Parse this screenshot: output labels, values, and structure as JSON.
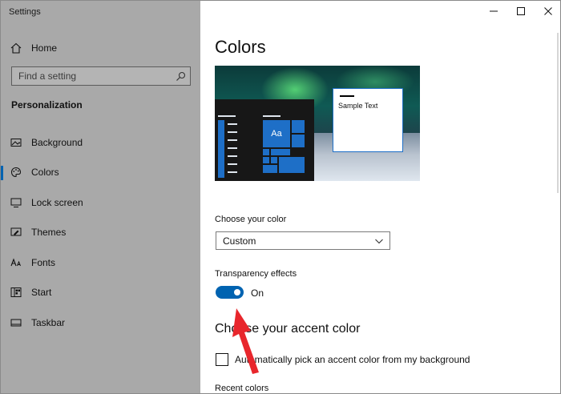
{
  "window": {
    "title": "Settings"
  },
  "sidebar": {
    "home_label": "Home",
    "search_placeholder": "Find a setting",
    "section": "Personalization",
    "items": [
      {
        "label": "Background",
        "icon": "picture-icon"
      },
      {
        "label": "Colors",
        "icon": "palette-icon",
        "active": true
      },
      {
        "label": "Lock screen",
        "icon": "lock-screen-icon"
      },
      {
        "label": "Themes",
        "icon": "brush-icon"
      },
      {
        "label": "Fonts",
        "icon": "font-icon"
      },
      {
        "label": "Start",
        "icon": "start-grid-icon"
      },
      {
        "label": "Taskbar",
        "icon": "taskbar-icon"
      }
    ]
  },
  "main": {
    "title": "Colors",
    "preview": {
      "sample_text": "Sample Text",
      "tile_text": "Aa"
    },
    "choose_color": {
      "label": "Choose your color",
      "value": "Custom"
    },
    "transparency": {
      "label": "Transparency effects",
      "state": "On",
      "enabled": true
    },
    "accent": {
      "heading": "Choose your accent color",
      "auto_pick_label": "Automatically pick an accent color from my background",
      "recent_label": "Recent colors"
    }
  },
  "colors": {
    "accent": "#0063b1",
    "sidebar_bg": "#a9a9a9",
    "annotation": "#e8262c"
  }
}
